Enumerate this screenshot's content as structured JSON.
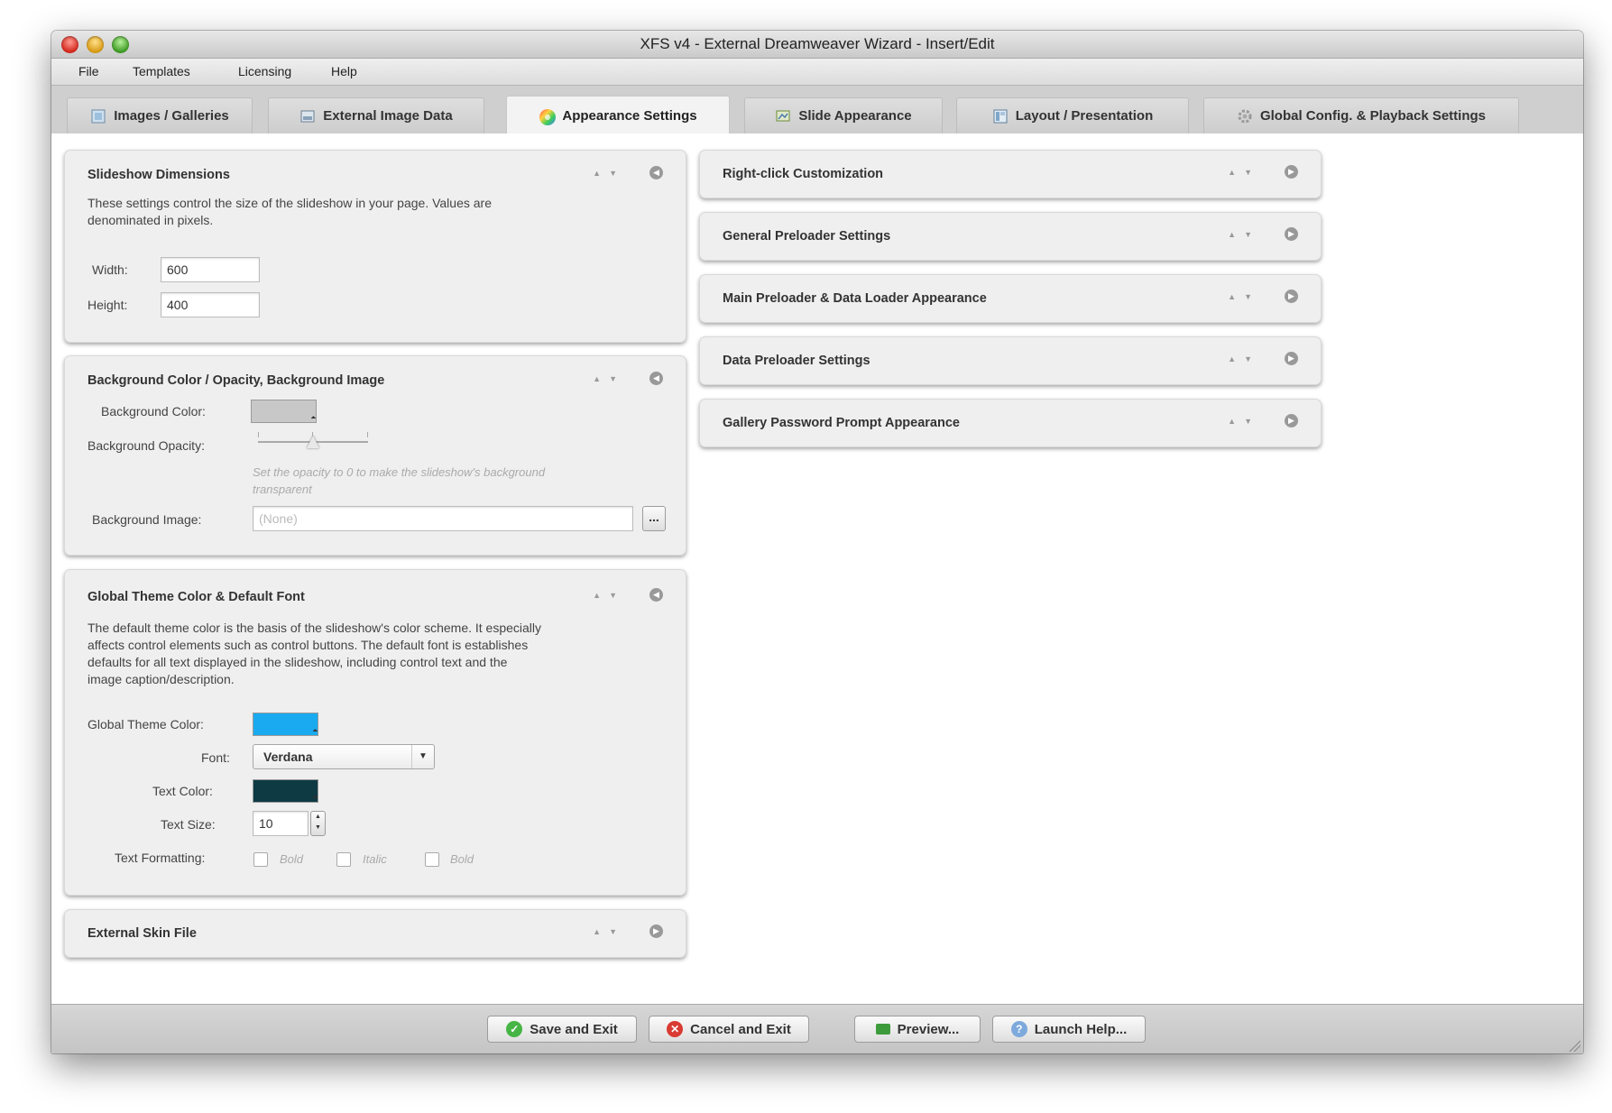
{
  "window": {
    "title": "XFS v4 - External Dreamweaver Wizard - Insert/Edit"
  },
  "menu": {
    "items": [
      "File",
      "Templates",
      "Licensing",
      "Help"
    ]
  },
  "tabs": [
    {
      "label": "Images / Galleries",
      "icon": "images-icon"
    },
    {
      "label": "External Image Data",
      "icon": "image-data-icon"
    },
    {
      "label": "Appearance Settings",
      "icon": "color-wheel-icon",
      "active": true
    },
    {
      "label": "Slide Appearance",
      "icon": "slide-icon"
    },
    {
      "label": "Layout / Presentation",
      "icon": "layout-icon"
    },
    {
      "label": "Global Config. & Playback Settings",
      "icon": "gear-icon"
    }
  ],
  "left": {
    "dimensions": {
      "title": "Slideshow Dimensions",
      "desc1": "These settings control the size of the slideshow in your page.  Values are",
      "desc2": "denominated in pixels.",
      "width_label": "Width:",
      "width_value": "600",
      "height_label": "Height:",
      "height_value": "400"
    },
    "background": {
      "title": "Background Color / Opacity, Background Image",
      "color_label": "Background Color:",
      "color_value": "#c8c8c8",
      "opacity_label": "Background Opacity:",
      "hint1": "Set the opacity to 0 to make the slideshow's background",
      "hint2": "transparent",
      "image_label": "Background Image:",
      "image_placeholder": "(None)",
      "browse_label": "..."
    },
    "theme": {
      "title": "Global Theme Color & Default Font",
      "desc1": "The default theme color is the basis of the slideshow's color scheme.  It especially",
      "desc2": "affects control elements such as control buttons.  The default font is establishes",
      "desc3": "defaults for all text displayed in the slideshow, including control text and the",
      "desc4": "image caption/description.",
      "theme_color_label": "Global Theme Color:",
      "theme_color_value": "#1aaaf0",
      "font_label": "Font:",
      "font_value": "Verdana",
      "text_color_label": "Text Color:",
      "text_color_value": "#0e3a44",
      "text_size_label": "Text Size:",
      "text_size_value": "10",
      "formatting_label": "Text Formatting:",
      "format_options": [
        "Bold",
        "Italic",
        "Bold"
      ]
    },
    "skin": {
      "title": "External Skin File"
    }
  },
  "right": {
    "panels": [
      "Right-click Customization",
      "General Preloader Settings",
      "Main Preloader & Data Loader Appearance",
      "Data Preloader Settings",
      "Gallery Password Prompt Appearance"
    ]
  },
  "footer": {
    "save": "Save and Exit",
    "cancel": "Cancel and Exit",
    "preview": "Preview...",
    "help": "Launch Help..."
  }
}
